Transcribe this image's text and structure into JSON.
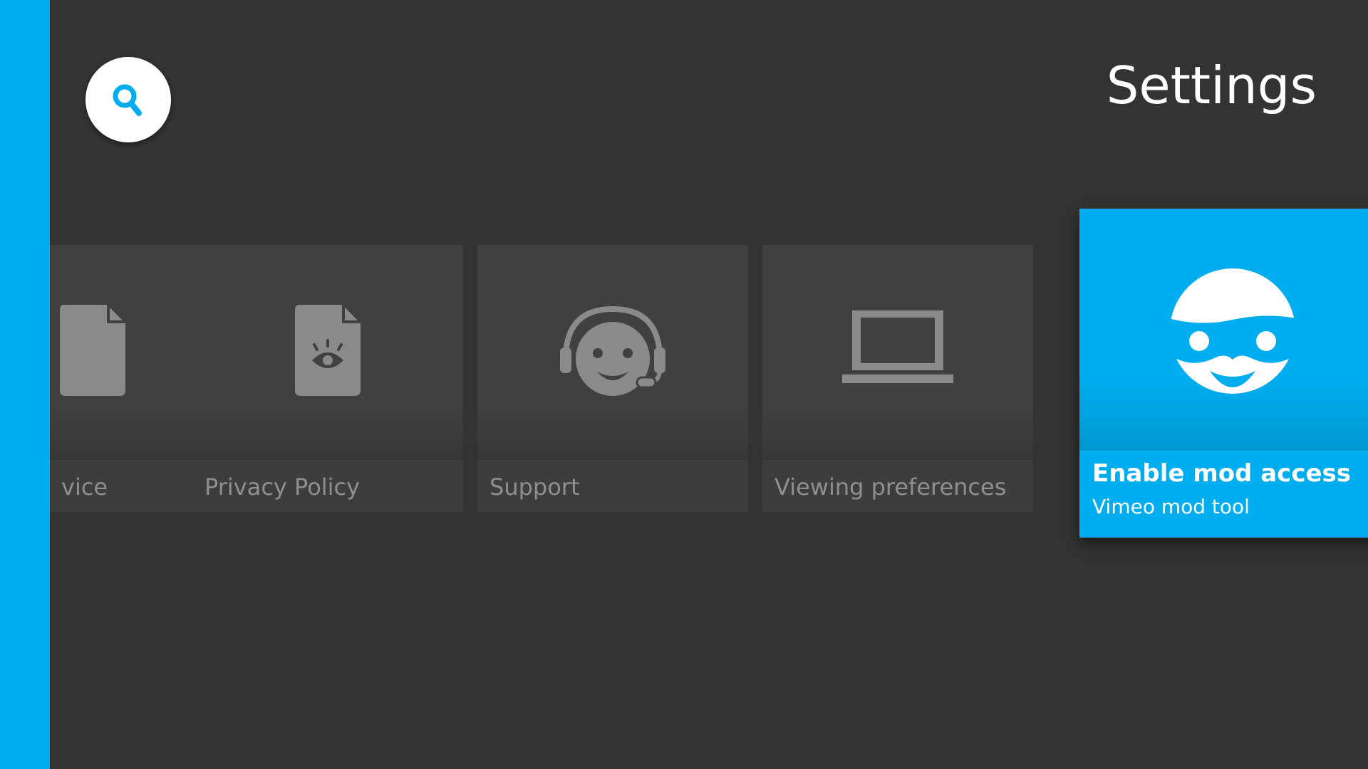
{
  "header": {
    "title": "Settings",
    "search_icon": "search-icon"
  },
  "cards": [
    {
      "label": "vice",
      "icon": "document-icon"
    },
    {
      "label": "Privacy Policy",
      "icon": "privacy-document-eye-icon"
    },
    {
      "label": "Support",
      "icon": "headset-smiley-icon"
    },
    {
      "label": "Viewing preferences",
      "icon": "laptop-icon"
    }
  ],
  "focused_card": {
    "title": "Enable mod access",
    "subtitle": "Vimeo mod tool",
    "icon": "masked-face-icon"
  },
  "colors": {
    "accent": "#00adef",
    "background": "#333333",
    "card": "#3d3d3d",
    "muted_text": "#8f8f8f"
  }
}
